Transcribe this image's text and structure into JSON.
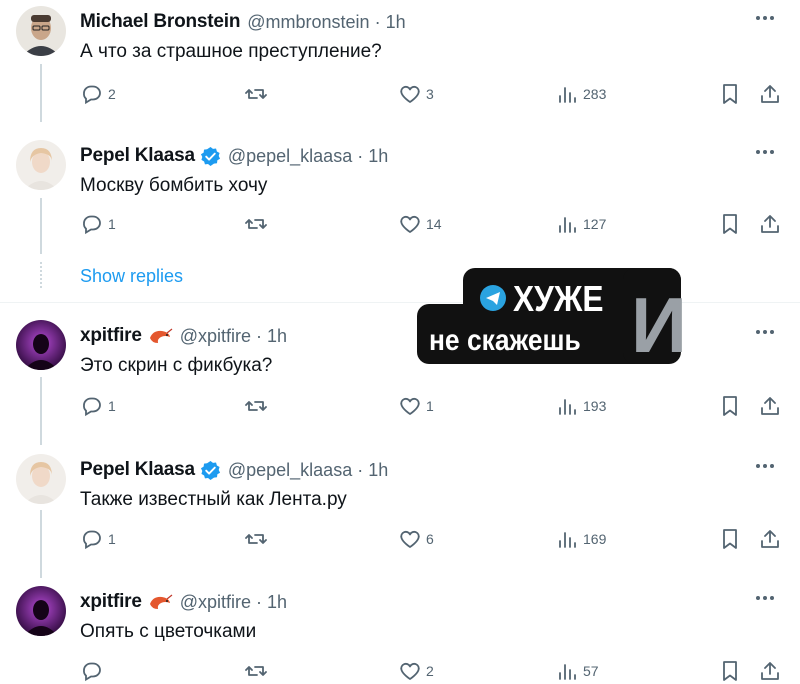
{
  "tweets": [
    {
      "name": "Michael Bronstein",
      "handle": "@mmbronstein",
      "time": "1h",
      "text": "А что за страшное преступление?",
      "replies": "2",
      "retweets": "",
      "likes": "3",
      "views": "283",
      "badge": "none"
    },
    {
      "name": "Pepel Klaasa",
      "handle": "@pepel_klaasa",
      "time": "1h",
      "text": "Москву бомбить хочу",
      "replies": "1",
      "retweets": "",
      "likes": "14",
      "views": "127",
      "badge": "verified"
    },
    {
      "name": "xpitfire",
      "handle": "@xpitfire",
      "time": "1h",
      "text": "Это скрин с фикбука?",
      "replies": "1",
      "retweets": "",
      "likes": "1",
      "views": "193",
      "badge": "shrimp"
    },
    {
      "name": "Pepel Klaasa",
      "handle": "@pepel_klaasa",
      "time": "1h",
      "text": "Также известный как Лента.ру",
      "replies": "1",
      "retweets": "",
      "likes": "6",
      "views": "169",
      "badge": "verified"
    },
    {
      "name": "xpitfire",
      "handle": "@xpitfire",
      "time": "1h",
      "text": "Опять с цветочками",
      "replies": "",
      "retweets": "",
      "likes": "2",
      "views": "57",
      "badge": "shrimp"
    }
  ],
  "show_replies": "Show replies",
  "watermark": {
    "line1": "ХУЖЕ",
    "line2": "не скажешь",
    "letter": "И"
  },
  "colors": {
    "accent": "#1d9bf0",
    "muted": "#536471",
    "text": "#0f1419"
  },
  "icons": [
    "reply-icon",
    "retweet-icon",
    "like-icon",
    "views-icon",
    "bookmark-icon",
    "share-icon",
    "more-icon",
    "verified-icon",
    "shrimp-icon",
    "telegram-icon"
  ]
}
